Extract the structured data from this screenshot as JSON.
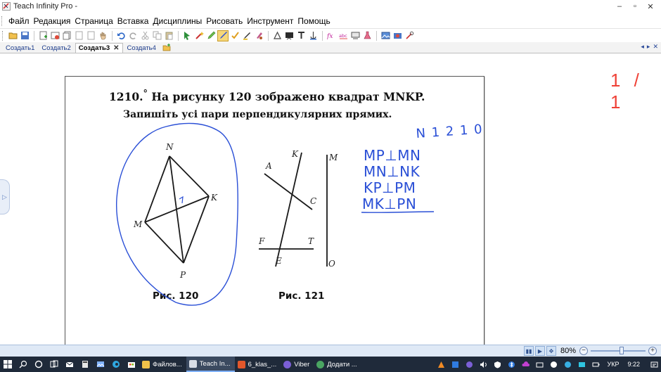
{
  "window": {
    "title": "Teach Infinity Pro -",
    "minimize": "–",
    "maximize": "▫",
    "close": "✕"
  },
  "menu": {
    "items": [
      "Файл",
      "Редакция",
      "Страница",
      "Вставка",
      "Дисциплины",
      "Рисовать",
      "Инструмент",
      "Помощь"
    ]
  },
  "toolbar": {
    "icons": [
      "open-folder-icon",
      "save-icon",
      "new-page-icon",
      "insert-image-icon",
      "copy-page-icon",
      "page-prev-icon",
      "page-next-icon",
      "hand-icon",
      "undo-icon",
      "redo-icon",
      "cut-icon",
      "copy-icon",
      "paste-icon",
      "select-arrow-icon",
      "magic-icon",
      "highlighter-icon",
      "pen-icon",
      "check-pen-icon",
      "marker-icon",
      "pencil-icon",
      "triangle-icon",
      "board-icon",
      "text-icon",
      "anchor-icon",
      "formula-icon",
      "spell-icon",
      "screen-capture-icon",
      "flask-icon",
      "image-icon",
      "camera-icon",
      "settings-icon"
    ],
    "active": "pen-icon"
  },
  "tabs": {
    "items": [
      {
        "label": "Создать1",
        "active": false
      },
      {
        "label": "Создать2",
        "active": false
      },
      {
        "label": "Создать3",
        "active": true,
        "close": "✕"
      },
      {
        "label": "Создать4",
        "active": false
      }
    ],
    "nav": [
      "◂",
      "▸",
      "✕"
    ]
  },
  "canvas": {
    "page_counter": "1 / 1",
    "handle_glyph": "▷"
  },
  "document": {
    "problem_number": "1210.",
    "problem_mark": "°",
    "line1": "На рисунку 120 зображено квадрат MNKP.",
    "line2": "Запишіть усі пари перпендикулярних прямих.",
    "fig120": {
      "caption": "Рис. 120",
      "points": {
        "N": "N",
        "K": "K",
        "M": "M",
        "P": "P"
      }
    },
    "fig121": {
      "caption": "Рис. 121",
      "points": {
        "A": "A",
        "K": "K",
        "C": "C",
        "M": "M",
        "F": "F",
        "T": "T",
        "E": "E",
        "O": "O"
      }
    }
  },
  "handwriting": {
    "color": "#2a4fd6",
    "title": "N 1 2 1 0",
    "lines": [
      "MP⊥MN",
      "MN⊥NK",
      "KP⊥PM",
      "MK⊥PN"
    ]
  },
  "statusbar": {
    "zoom": "80%",
    "zoom_level": 0.8,
    "zoom_minus": "−",
    "zoom_plus": "+"
  },
  "taskbar": {
    "apps": [
      {
        "label": "Файлов...",
        "icon": "folder-icon",
        "color": "#f0c24a",
        "active": false
      },
      {
        "label": "Teach In...",
        "icon": "teach-infinity-icon",
        "color": "#d9dee7",
        "active": true
      },
      {
        "label": "6_klas_...",
        "icon": "pdf-icon",
        "color": "#e2572b",
        "active": false
      },
      {
        "label": "Viber",
        "icon": "viber-icon",
        "color": "#7b5fd6",
        "active": false
      },
      {
        "label": "Додати ...",
        "icon": "chrome-icon",
        "color": "#4aa562",
        "active": false
      }
    ],
    "language": "УКР",
    "time": "9:22"
  }
}
